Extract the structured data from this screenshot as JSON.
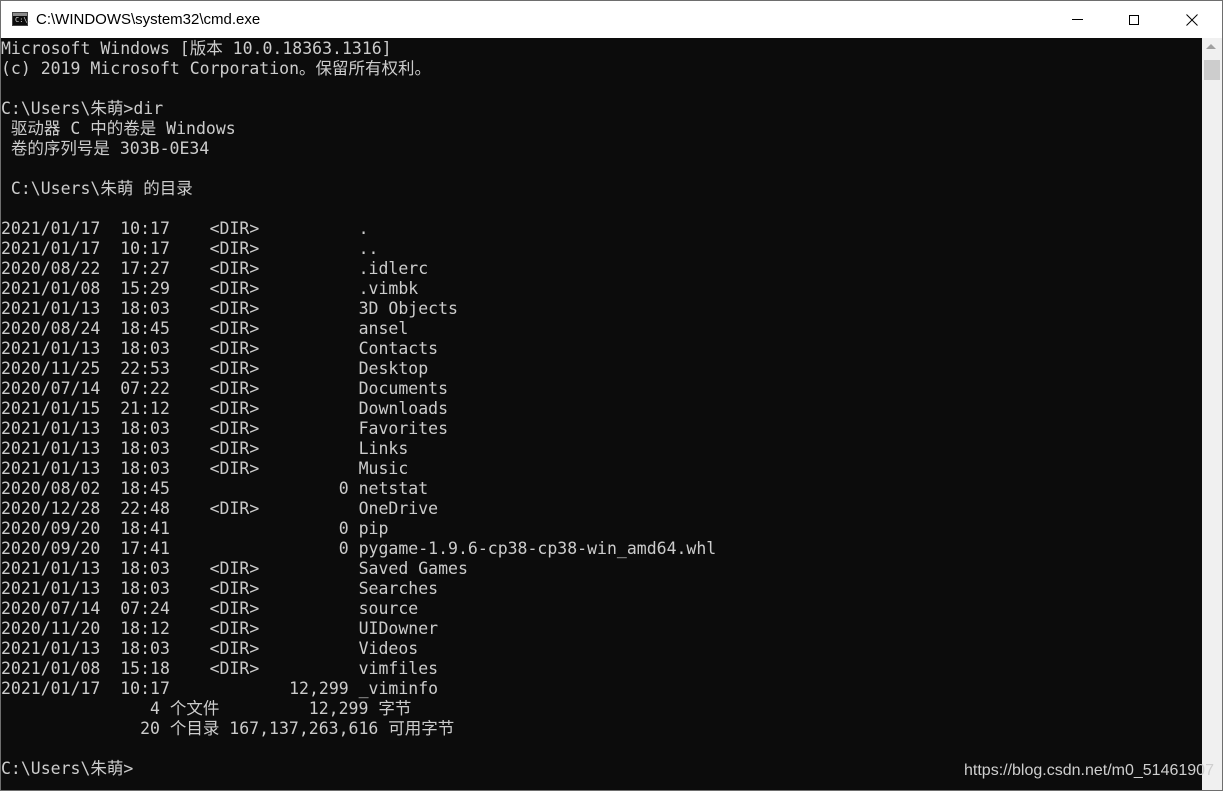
{
  "window": {
    "title": "C:\\WINDOWS\\system32\\cmd.exe",
    "icon": "cmd-icon",
    "icon_text": "C:\\."
  },
  "console": {
    "lines": [
      "Microsoft Windows [版本 10.0.18363.1316]",
      "(c) 2019 Microsoft Corporation。保留所有权利。",
      "",
      "C:\\Users\\朱萌>dir",
      " 驱动器 C 中的卷是 Windows",
      " 卷的序列号是 303B-0E34",
      "",
      " C:\\Users\\朱萌 的目录",
      "",
      "2021/01/17  10:17    <DIR>          .",
      "2021/01/17  10:17    <DIR>          ..",
      "2020/08/22  17:27    <DIR>          .idlerc",
      "2021/01/08  15:29    <DIR>          .vimbk",
      "2021/01/13  18:03    <DIR>          3D Objects",
      "2020/08/24  18:45    <DIR>          ansel",
      "2021/01/13  18:03    <DIR>          Contacts",
      "2020/11/25  22:53    <DIR>          Desktop",
      "2020/07/14  07:22    <DIR>          Documents",
      "2021/01/15  21:12    <DIR>          Downloads",
      "2021/01/13  18:03    <DIR>          Favorites",
      "2021/01/13  18:03    <DIR>          Links",
      "2021/01/13  18:03    <DIR>          Music",
      "2020/08/02  18:45                 0 netstat",
      "2020/12/28  22:48    <DIR>          OneDrive",
      "2020/09/20  18:41                 0 pip",
      "2020/09/20  17:41                 0 pygame-1.9.6-cp38-cp38-win_amd64.whl",
      "2021/01/13  18:03    <DIR>          Saved Games",
      "2021/01/13  18:03    <DIR>          Searches",
      "2020/07/14  07:24    <DIR>          source",
      "2020/11/20  18:12    <DIR>          UIDowner",
      "2021/01/13  18:03    <DIR>          Videos",
      "2021/01/08  15:18    <DIR>          vimfiles",
      "2021/01/17  10:17            12,299 _viminfo",
      "               4 个文件         12,299 字节",
      "              20 个目录 167,137,263,616 可用字节",
      "",
      "C:\\Users\\朱萌>"
    ]
  },
  "watermark": "https://blog.csdn.net/m0_51461907"
}
